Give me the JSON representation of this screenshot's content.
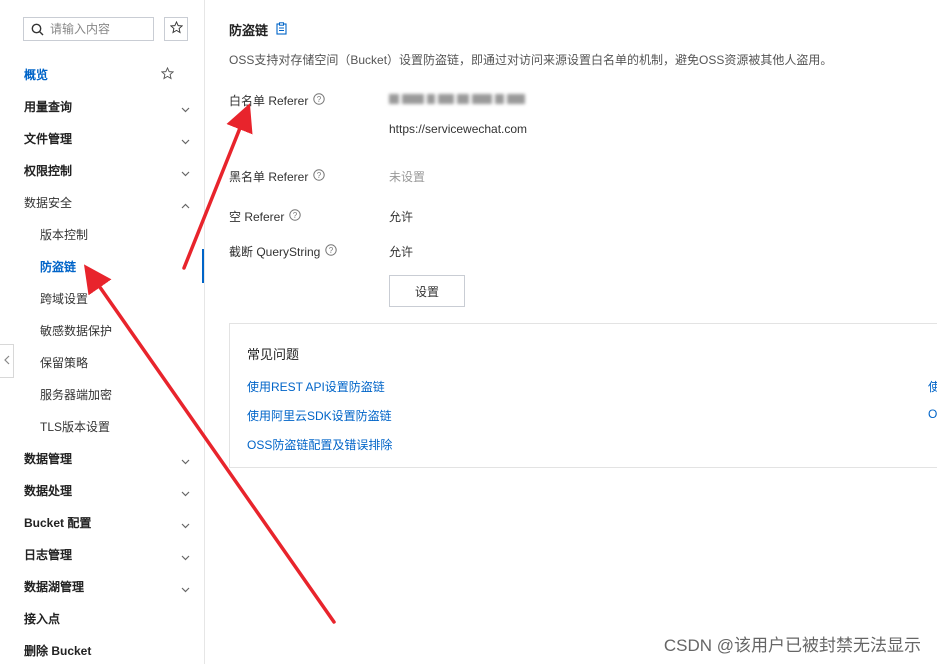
{
  "sidebar": {
    "search_placeholder": "请输入内容",
    "items": [
      {
        "label": "概览",
        "type": "overview",
        "active_color": "#0064c8"
      },
      {
        "label": "用量查询",
        "expandable": true
      },
      {
        "label": "文件管理",
        "expandable": true
      },
      {
        "label": "权限控制",
        "expandable": true
      },
      {
        "label": "数据安全",
        "expanded": true
      },
      {
        "label": "版本控制",
        "sub": true
      },
      {
        "label": "防盗链",
        "sub": true,
        "active": true
      },
      {
        "label": "跨域设置",
        "sub": true
      },
      {
        "label": "敏感数据保护",
        "sub": true
      },
      {
        "label": "保留策略",
        "sub": true
      },
      {
        "label": "服务器端加密",
        "sub": true
      },
      {
        "label": "TLS版本设置",
        "sub": true
      },
      {
        "label": "数据管理",
        "expandable": true
      },
      {
        "label": "数据处理",
        "expandable": true
      },
      {
        "label": "Bucket 配置",
        "expandable": true
      },
      {
        "label": "日志管理",
        "expandable": true
      },
      {
        "label": "数据湖管理",
        "expandable": true
      },
      {
        "label": "接入点"
      },
      {
        "label": "删除 Bucket"
      }
    ]
  },
  "main": {
    "title": "防盗链",
    "description": "OSS支持对存储空间（Bucket）设置防盗链，即通过对访问来源设置白名单的机制，避免OSS资源被其他人盗用。",
    "fields": {
      "whitelist_label": "白名单 Referer",
      "whitelist_value": "https://servicewechat.com",
      "blacklist_label": "黑名单 Referer",
      "blacklist_value": "未设置",
      "empty_label": "空 Referer",
      "empty_value": "允许",
      "truncate_label": "截断 QueryString",
      "truncate_value": "允许"
    },
    "set_button": "设置",
    "faq": {
      "title": "常见问题",
      "links": [
        "使用REST API设置防盗链",
        "使用阿里云SDK设置防盗链",
        "OSS防盗链配置及错误排除"
      ],
      "right_links": [
        "使",
        "O"
      ]
    }
  },
  "watermark": "CSDN @该用户已被封禁无法显示",
  "colors": {
    "accent": "#0064c8",
    "arrow": "#e8242c"
  }
}
